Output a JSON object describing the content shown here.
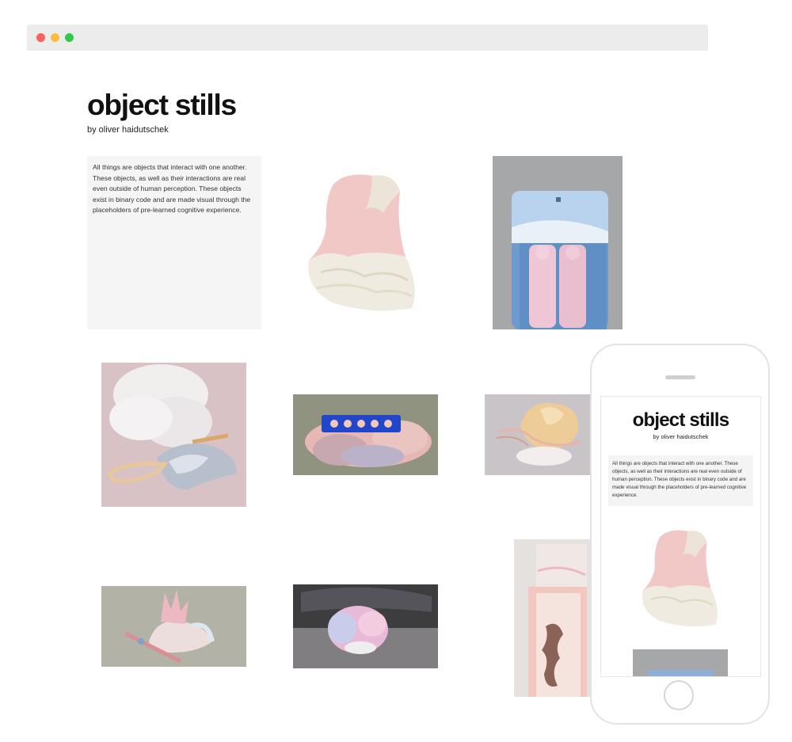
{
  "site": {
    "title": "object stills",
    "byline": "by oliver haidutschek",
    "intro": "All things are objects that interact with one another. These objects, as well as their interactions are real even outside of human perception. These objects exist in binary code and are made visual through the placeholders of pre-learned cognitive experience."
  },
  "gallery": {
    "items": [
      {
        "icon": "pink-stone-sculpture-icon"
      },
      {
        "icon": "blister-pack-figures-icon"
      },
      {
        "icon": "smoke-shell-sculpture-icon"
      },
      {
        "icon": "pastel-cluster-blue-tray-icon"
      },
      {
        "icon": "peach-flower-sculpture-icon"
      },
      {
        "icon": "pastel-swan-sculpture-icon"
      },
      {
        "icon": "marbled-blob-on-seat-icon"
      },
      {
        "icon": "pink-box-tower-icon"
      }
    ]
  },
  "mobile": {
    "title": "object stills",
    "byline": "by oliver haidutschek",
    "intro": "All things are objects that interact with one another. These objects, as well as their interactions are real even outside of human perception. These objects exist in binary code and are made visual through the placeholders of pre-learned cognitive experience."
  },
  "colors": {
    "background": "#ffffff",
    "browser_bar": "#ececec",
    "intro_box": "#f5f5f5",
    "close_dot": "#fc605c",
    "minimize_dot": "#fdbc40",
    "zoom_dot": "#34c84a"
  }
}
